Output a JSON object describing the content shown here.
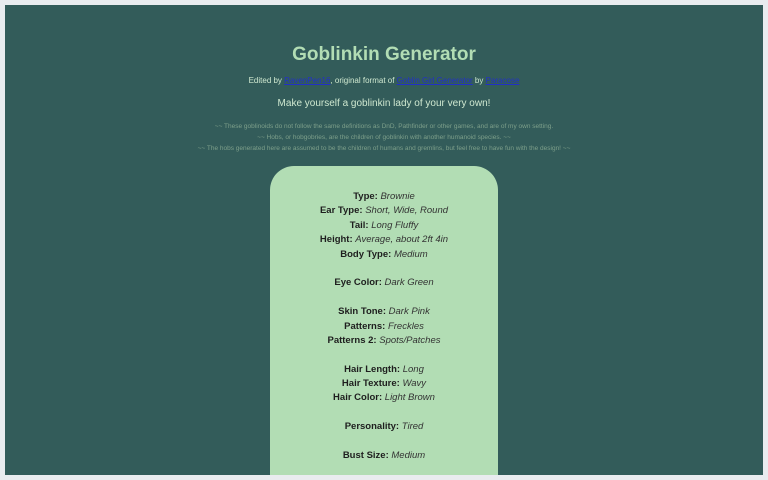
{
  "header": {
    "title": "Goblinkin Generator",
    "credits": {
      "prefix": "Edited by ",
      "editor_link": "RavenPen16",
      "middle": ", original format of ",
      "original_link": "Goblin Girl Generator",
      "by": " by ",
      "author_link": "Paracose"
    },
    "tagline": "Make yourself a goblinkin lady of your very own!",
    "notes": [
      "~~ These goblinoids do not follow the same definitions as DnD, Pathfinder or other games, and are of my own setting.",
      "~~ Hobs, or hobgobries, are the children of goblinkin with another humanoid species. ~~",
      "~~ The hobs generated here are assumed to be the children of humans and gremlins, but feel free to have fun with the design! ~~"
    ]
  },
  "card": {
    "type": {
      "label": "Type:",
      "value": "Brownie"
    },
    "ear_type": {
      "label": "Ear Type:",
      "value": "Short, Wide, Round"
    },
    "tail": {
      "label": "Tail:",
      "value": "Long Fluffy"
    },
    "height": {
      "label": "Height:",
      "value": "Average, about 2ft 4in"
    },
    "body_type": {
      "label": "Body Type:",
      "value": "Medium"
    },
    "eye_color": {
      "label": "Eye Color:",
      "value": "Dark Green"
    },
    "skin_tone": {
      "label": "Skin Tone:",
      "value": "Dark Pink"
    },
    "patterns": {
      "label": "Patterns:",
      "value": "Freckles"
    },
    "patterns_2": {
      "label": "Patterns 2:",
      "value": "Spots/Patches"
    },
    "hair_length": {
      "label": "Hair Length:",
      "value": "Long"
    },
    "hair_texture": {
      "label": "Hair Texture:",
      "value": "Wavy"
    },
    "hair_color": {
      "label": "Hair Color:",
      "value": "Light Brown"
    },
    "personality": {
      "label": "Personality:",
      "value": "Tired"
    },
    "bust_size": {
      "label": "Bust Size:",
      "value": "Medium"
    }
  },
  "colors": {
    "background": "#335c5a",
    "title": "#b2ddb4",
    "card": "#b2ddb4",
    "link": "#2230c8"
  }
}
